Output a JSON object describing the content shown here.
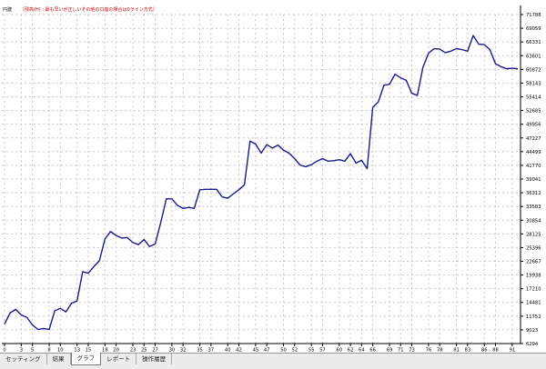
{
  "header": {
    "symbol_label": "円建",
    "note_text": "（残高(H) : 最も早いが正しいその他の口座の場合は0ライン方式）"
  },
  "tabs": [
    {
      "label": "セッティング",
      "active": false
    },
    {
      "label": "結果",
      "active": false
    },
    {
      "label": "グラフ",
      "active": true
    },
    {
      "label": "レポート",
      "active": false
    },
    {
      "label": "操作履歴",
      "active": false
    }
  ],
  "colors": {
    "line": "#1a1a8c",
    "note": "#cc0000",
    "grid": "#c8c8c8"
  },
  "chart_data": {
    "type": "line",
    "grid": true,
    "ylim": [
      6294,
      71788
    ],
    "y_ticks": [
      71788,
      69059,
      66331,
      63601,
      60872,
      58143,
      55414,
      52685,
      49956,
      47227,
      44499,
      41770,
      39041,
      36312,
      33583,
      30854,
      28125,
      25396,
      22667,
      19938,
      17210,
      14481,
      11752,
      9023,
      6294
    ],
    "x_ticks": [
      "0",
      "3",
      "5",
      "8",
      "10",
      "13",
      "15",
      "18",
      "20",
      "23",
      "25",
      "27",
      "30",
      "32",
      "35",
      "37",
      "40",
      "42",
      "45",
      "47",
      "50",
      "52",
      "55",
      "57",
      "60",
      "62",
      "64",
      "66",
      "69",
      "71",
      "73",
      "76",
      "78",
      "81",
      "83",
      "86",
      "88",
      "91"
    ],
    "series": [
      {
        "x": [
          0,
          1,
          2,
          3,
          4,
          5,
          6,
          7,
          8,
          9,
          10,
          11,
          12,
          13,
          14,
          15,
          16,
          17,
          18,
          19,
          20,
          21,
          22,
          23,
          24,
          25,
          26,
          27,
          28,
          29,
          30,
          31,
          32,
          33,
          34,
          35,
          36,
          37,
          38,
          39,
          40,
          41,
          42,
          43,
          44,
          45,
          46,
          47,
          48,
          49,
          50,
          51,
          52,
          53,
          54,
          55,
          56,
          57,
          58,
          59,
          60,
          61,
          62,
          63,
          64,
          65,
          66,
          67,
          68,
          69,
          70,
          71,
          72,
          73,
          74,
          75,
          76,
          77,
          78,
          79,
          80,
          81,
          82,
          83,
          84,
          85,
          86,
          87,
          88,
          89,
          90,
          91,
          92
        ],
        "values": [
          10200,
          12400,
          13100,
          12000,
          11500,
          10000,
          9100,
          9300,
          9100,
          12800,
          13300,
          12600,
          14300,
          14800,
          20600,
          20300,
          21600,
          22800,
          27100,
          28600,
          27800,
          27300,
          27400,
          26400,
          26000,
          27000,
          25600,
          26100,
          30400,
          35100,
          35100,
          33800,
          33200,
          33400,
          33200,
          36900,
          37000,
          37000,
          37000,
          35500,
          35200,
          36100,
          36900,
          37900,
          46600,
          46000,
          44200,
          45900,
          45200,
          45800,
          44800,
          44200,
          43100,
          41800,
          41500,
          41900,
          42600,
          43100,
          42600,
          42700,
          42900,
          42600,
          44100,
          42200,
          42800,
          41100,
          53300,
          54400,
          57700,
          57900,
          59900,
          59200,
          58700,
          56100,
          55700,
          61300,
          64100,
          65000,
          64900,
          64200,
          64500,
          65000,
          64800,
          64500,
          67600,
          65900,
          65800,
          64800,
          62000,
          61400,
          61000,
          61100,
          61000
        ]
      }
    ]
  }
}
